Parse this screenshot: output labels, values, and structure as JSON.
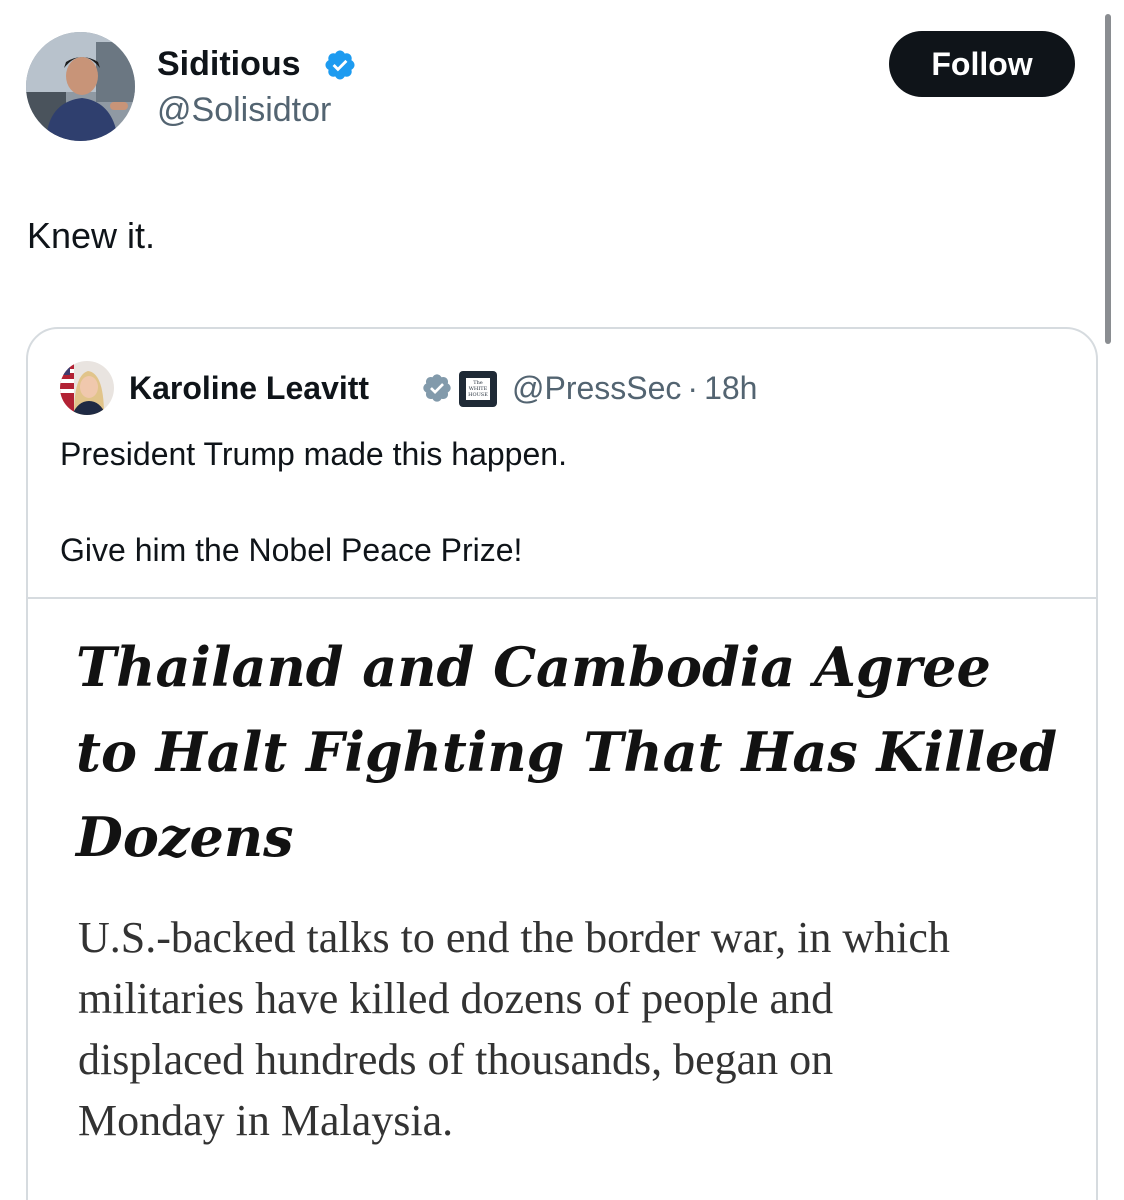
{
  "tweet": {
    "author": {
      "name": "Siditious",
      "handle": "@Solisidtor",
      "verified": true
    },
    "follow_label": "Follow",
    "text": "Knew it."
  },
  "quote": {
    "author": {
      "name": "Karoline Leavitt",
      "handle": "@PressSec",
      "separator": "·",
      "time": "18h",
      "verified_color": "gray",
      "affiliate_badge": {
        "line1": "The",
        "line2": "WHITE",
        "line3": "HOUSE"
      }
    },
    "text_line1": "President Trump made this happen.",
    "text_line2": "Give him the Nobel Peace Prize!",
    "media": {
      "headline_lines": [
        "Thailand and Cambodia Agree",
        "to Halt Fighting That Has Killed",
        "Dozens"
      ],
      "summary_lines": [
        "U.S.-backed talks to end the border war, in which",
        "militaries have killed dozens of people and",
        "displaced hundreds of thousands, began on",
        "Monday in Malaysia."
      ]
    }
  },
  "colors": {
    "text_primary": "#0f1419",
    "text_secondary": "#536471",
    "verified_blue": "#1d9bf0",
    "verified_gray": "#829aab",
    "follow_bg": "#0f1419",
    "border": "#d6dbdf"
  }
}
